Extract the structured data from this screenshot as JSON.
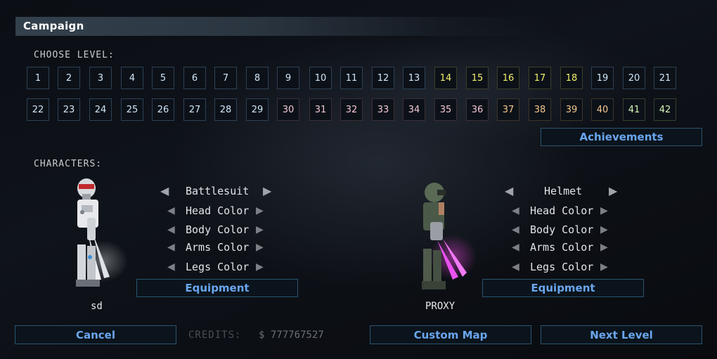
{
  "header": {
    "title": "Campaign"
  },
  "levels": {
    "label": "CHOOSE LEVEL:",
    "row1": [
      "1",
      "2",
      "3",
      "4",
      "5",
      "6",
      "7",
      "8",
      "9",
      "10",
      "11",
      "12",
      "13",
      "14",
      "15",
      "16",
      "17",
      "18",
      "19",
      "20",
      "21"
    ],
    "row2": [
      "22",
      "23",
      "24",
      "25",
      "26",
      "27",
      "28",
      "29",
      "30",
      "31",
      "32",
      "33",
      "34",
      "35",
      "36",
      "37",
      "38",
      "39",
      "40",
      "41",
      "42"
    ]
  },
  "achievements_label": "Achievements",
  "characters": {
    "label": "CHARACTERS:",
    "player1": {
      "name": "sd",
      "options": [
        "Battlesuit",
        "Head Color",
        "Body Color",
        "Arms Color",
        "Legs Color"
      ],
      "equipment_label": "Equipment"
    },
    "player2": {
      "name": "PROXY",
      "options": [
        "Helmet",
        "Head Color",
        "Body Color",
        "Arms Color",
        "Legs Color"
      ],
      "equipment_label": "Equipment"
    }
  },
  "footer": {
    "cancel_label": "Cancel",
    "credits_label": "CREDITS:",
    "credits_value": "$ 777767527",
    "custom_map_label": "Custom Map",
    "next_level_label": "Next Level"
  },
  "colors": {
    "accent": "#6aa6ee",
    "level_blue": "#cfe6f7",
    "level_yellow": "#f2f06a",
    "level_pink": "#f1c6d6",
    "level_orange": "#f4c890",
    "level_green": "#d4f5b6",
    "player2_blade": "#e040e8"
  }
}
